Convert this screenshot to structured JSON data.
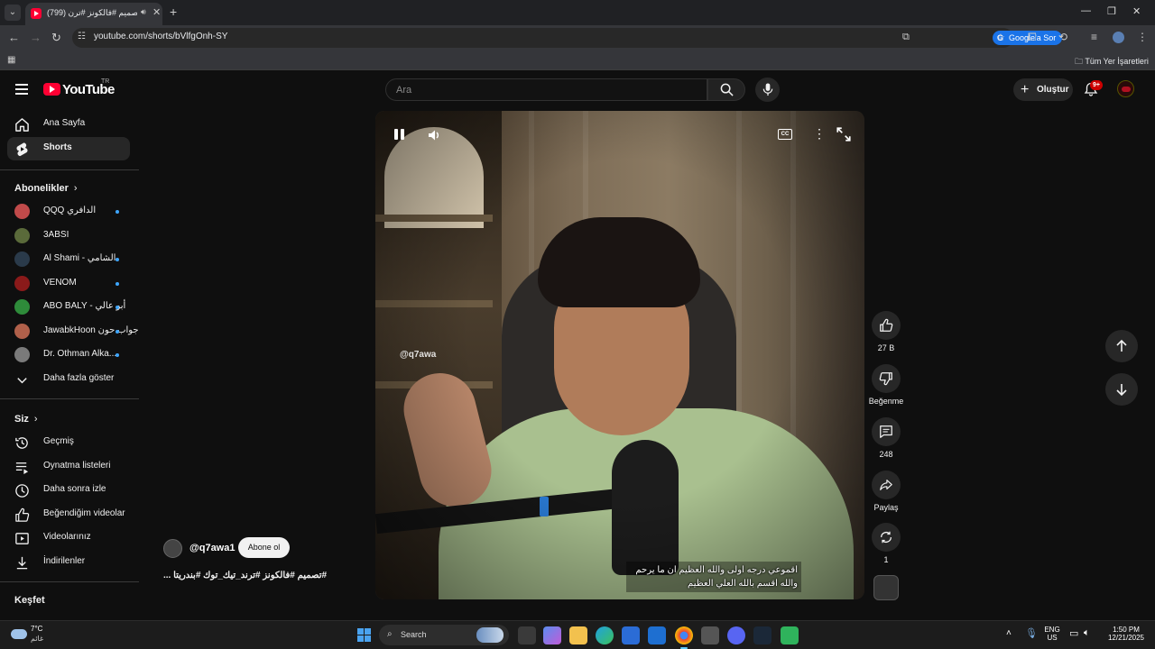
{
  "browser": {
    "tab_title": "تصميم #فالكونز #ترن (799)",
    "url": "youtube.com/shorts/bVlfgOnh-SY",
    "google_ask": "Google'a Sor",
    "all_bookmarks": "Tüm Yer İşaretleri"
  },
  "header": {
    "logo_text": "YouTube",
    "logo_country": "TR",
    "search_placeholder": "Ara",
    "create_label": "Oluştur",
    "notifications_badge": "9+"
  },
  "sidebar": {
    "main": [
      {
        "label": "Ana Sayfa",
        "icon": "home-icon"
      },
      {
        "label": "Shorts",
        "icon": "shorts-icon",
        "active": true
      }
    ],
    "subscriptions_heading": "Abonelikler",
    "subscriptions": [
      {
        "label": "QQQ الدافري",
        "dot": true,
        "color": "#c04a4a"
      },
      {
        "label": "3ABSI",
        "dot": false,
        "color": "#5a6a3a"
      },
      {
        "label": "Al Shami - الشامي",
        "dot": true,
        "color": "#2a3a4a"
      },
      {
        "label": "VENOM",
        "dot": true,
        "color": "#8a1a1a"
      },
      {
        "label": "ABO BALY - أبو عالي",
        "dot": true,
        "color": "#2e8b3a"
      },
      {
        "label": "JawabkHoon جواب حون",
        "dot": true,
        "color": "#b0604a"
      },
      {
        "label": "Dr. Othman Alka...",
        "dot": true,
        "color": "#7a7a7a"
      }
    ],
    "show_more": "Daha fazla göster",
    "you_heading": "Siz",
    "you_items": [
      {
        "label": "Geçmiş",
        "icon": "history-icon"
      },
      {
        "label": "Oynatma listeleri",
        "icon": "playlists-icon"
      },
      {
        "label": "Daha sonra izle",
        "icon": "watch-later-icon"
      },
      {
        "label": "Beğendiğim videolar",
        "icon": "liked-videos-icon"
      },
      {
        "label": "Videolarınız",
        "icon": "your-videos-icon"
      },
      {
        "label": "İndirilenler",
        "icon": "downloads-icon"
      }
    ],
    "explore_heading": "Keşfet"
  },
  "short": {
    "watermark": "@q7awa",
    "caption_line1": "اقموعي درجه اولى والله العظيم ان ما يرحم",
    "caption_line2": "والله اقسم بالله العلي العظيم",
    "channel": "@q7awa1",
    "subscribe_label": "Abone ol",
    "title": "#تصميم #فالكونز #ترند_تيك_توك #بندريتا ..."
  },
  "actions": {
    "likes": "27 B",
    "dislike_label": "Beğenme",
    "comments": "248",
    "share_label": "Paylaş",
    "remix_count": "1"
  },
  "taskbar": {
    "temperature": "7°C",
    "weather_desc": "غائم",
    "search_label": "Search",
    "lang_top": "ENG",
    "lang_bottom": "US",
    "time": "1:50 PM",
    "date": "12/21/2025"
  },
  "colors": {
    "youtube_red": "#ff0033",
    "accent_blue": "#1a73e8",
    "subscription_dot": "#3ea6ff"
  }
}
